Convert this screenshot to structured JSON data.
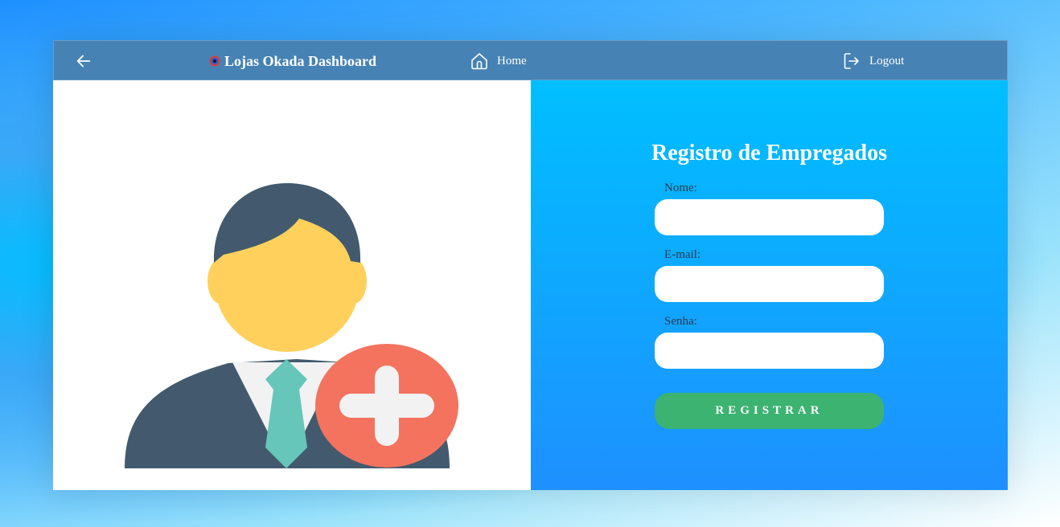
{
  "header": {
    "brand_title": "Lojas Okada Dashboard",
    "home_label": "Home",
    "logout_label": "Logout",
    "icons": [
      "arrow-left-icon",
      "brand-logo-icon",
      "home-icon",
      "logout-icon"
    ]
  },
  "form": {
    "title": "Registro de Empregados",
    "name_label": "Nome:",
    "email_label": "E-mail:",
    "password_label": "Senha:",
    "submit_label": "REGISTRAR"
  },
  "colors": {
    "header_bg": "#4682b4",
    "form_gradient_top": "#00bfff",
    "form_gradient_bottom": "#1e90ff",
    "submit_bg": "#3cb371",
    "badge_red": "#f3735f",
    "hair_dark": "#435a6e",
    "face_yellow": "#ffd15c",
    "tie_teal": "#66c6b9"
  }
}
